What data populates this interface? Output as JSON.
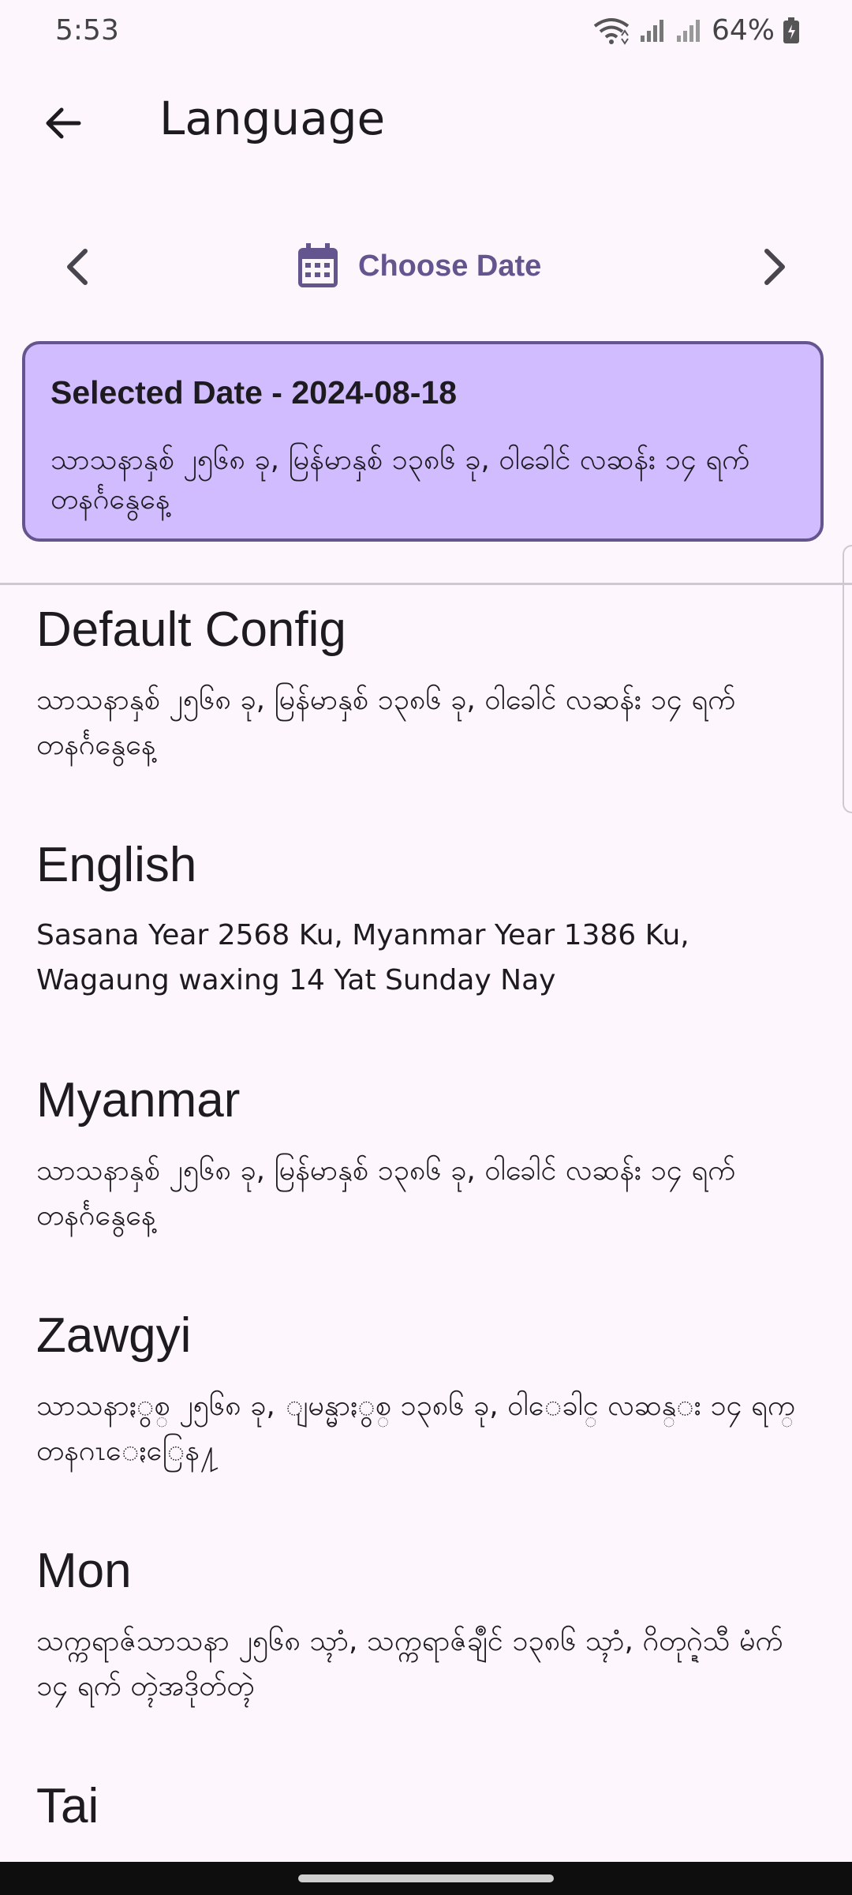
{
  "status": {
    "time": "5:53",
    "battery": "64%"
  },
  "app_bar": {
    "title": "Language"
  },
  "date_nav": {
    "choose_label": "Choose Date"
  },
  "selected": {
    "title": "Selected Date - 2024-08-18",
    "description": "သာသနာနှစ် ၂၅၆၈ ခု, မြန်မာနှစ် ၁၃၈၆ ခု, ဝါခေါင် လဆန်း ၁၄ ရက် တနင်္ဂနွေနေ့"
  },
  "languages": [
    {
      "name": "Default Config",
      "text": "သာသနာနှစ် ၂၅၆၈ ခု, မြန်မာနှစ် ၁၃၈၆ ခု, ဝါခေါင် လဆန်း ၁၄ ရက် တနင်္ဂနွေနေ့"
    },
    {
      "name": "English",
      "text": "Sasana Year 2568 Ku, Myanmar Year 1386 Ku, Wagaung waxing 14 Yat Sunday Nay"
    },
    {
      "name": "Myanmar",
      "text": "သာသနာနှစ် ၂၅၆၈ ခု, မြန်မာနှစ် ၁၃၈၆ ခု, ဝါခေါင် လဆန်း ၁၄ ရက် တနင်္ဂနွေနေ့"
    },
    {
      "name": "Zawgyi",
      "text": "သာသနာႏွစ္ ၂၅၆၈ ခု, ျမန္မာႏွစ္ ၁၃၈၆ ခု, ဝါေခါင္ လဆန္း ၁၄ ရက္ တနဂၤေႏြေန႔"
    },
    {
      "name": "Mon",
      "text": "သက္ကရာဇ်သာသနာ ၂၅၆၈ သ္ၚာံ, သက္ကရာဇ်ချဳင် ၁၃၈၆ သ္ၚာံ, ဂိတုဂ္ဍဲသီ မံက် ၁၄ ရက် တ္ၚဲအဒိုတ်တ္ၚဲ"
    },
    {
      "name": "Tai",
      "text": ""
    }
  ]
}
